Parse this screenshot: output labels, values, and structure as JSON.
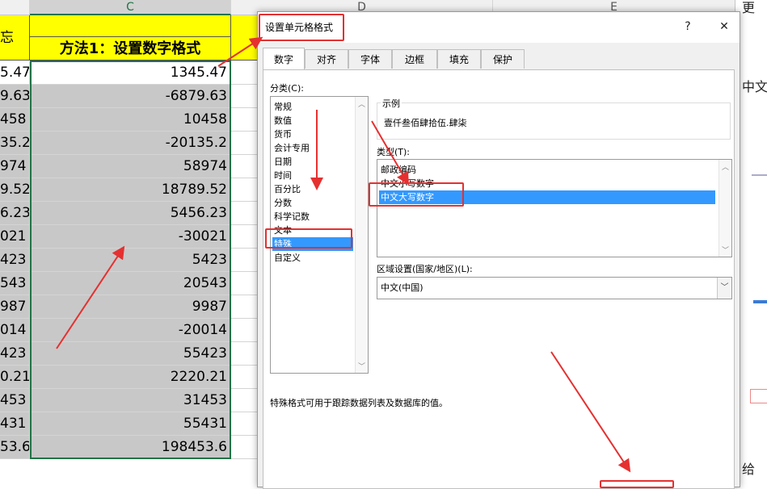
{
  "sheet": {
    "columns": [
      "C",
      "D",
      "E"
    ],
    "left_edge_values": [
      "忘",
      "5.47",
      "9.63",
      "458",
      "35.2",
      "974",
      "9.52",
      "6.23",
      "021",
      "423",
      "543",
      "987",
      "014",
      "423",
      "0.21",
      "453",
      "431",
      "53.6"
    ],
    "header_label": "方法1：设置数字格式",
    "values": [
      "1345.47",
      "-6879.63",
      "10458",
      "-20135.2",
      "58974",
      "18789.52",
      "5456.23",
      "-30021",
      "5423",
      "20543",
      "9987",
      "-20014",
      "55423",
      "2220.21",
      "31453",
      "55431",
      "198453.6"
    ],
    "right_strip_texts": [
      "更",
      "中文",
      "给"
    ]
  },
  "dialog": {
    "title": "设置单元格格式",
    "help_label": "?",
    "close_label": "✕",
    "tabs": [
      "数字",
      "对齐",
      "字体",
      "边框",
      "填充",
      "保护"
    ],
    "active_tab": "数字",
    "category_label": "分类(C):",
    "categories": [
      "常规",
      "数值",
      "货币",
      "会计专用",
      "日期",
      "时间",
      "百分比",
      "分数",
      "科学记数",
      "文本",
      "特殊",
      "自定义"
    ],
    "selected_category": "特殊",
    "sample_label": "示例",
    "sample_value": "壹仟叁佰肆拾伍.肆柒",
    "type_label": "类型(T):",
    "types": [
      "邮政编码",
      "中文小写数字",
      "中文大写数字"
    ],
    "selected_type": "中文大写数字",
    "locale_label": "区域设置(国家/地区)(L):",
    "locale_value": "中文(中国)",
    "description": "特殊格式可用于跟踪数据列表及数据库的值。"
  },
  "colors": {
    "header_yellow": "#ffff00",
    "cell_gray": "#c8c8c8",
    "selection_green": "#217346",
    "highlight_blue": "#3399ff",
    "annotation_red": "#e53030"
  }
}
